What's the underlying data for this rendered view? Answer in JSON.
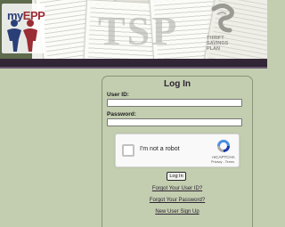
{
  "header": {
    "logo_prefix": "my",
    "logo_brand": "EPP",
    "logo_icon": "people-figures-icon",
    "background_letters": "TSP",
    "tsp_emblem": "tsp-swirl-icon",
    "tsp_text_line1": "THRIFT",
    "tsp_text_line2": "SAVINGS",
    "tsp_text_line3": "PLAN"
  },
  "login": {
    "title": "Log In",
    "user_id_label": "User ID:",
    "user_id_value": "",
    "password_label": "Password:",
    "password_value": "",
    "captcha_label": "I'm not a robot",
    "captcha_brand": "reCAPTCHA",
    "captcha_links": "Privacy - Terms",
    "login_button": "Log In",
    "forgot_user_id": "Forgot Your User ID?",
    "forgot_password": "Forgot Your Password?",
    "new_user_signup": "New User Sign Up"
  },
  "colors": {
    "page_background": "#c3ceb0",
    "stripe": "#352838",
    "logo_blue": "#2a3f78",
    "logo_red": "#9b2d34",
    "recaptcha_blue": "#4a90e2"
  }
}
